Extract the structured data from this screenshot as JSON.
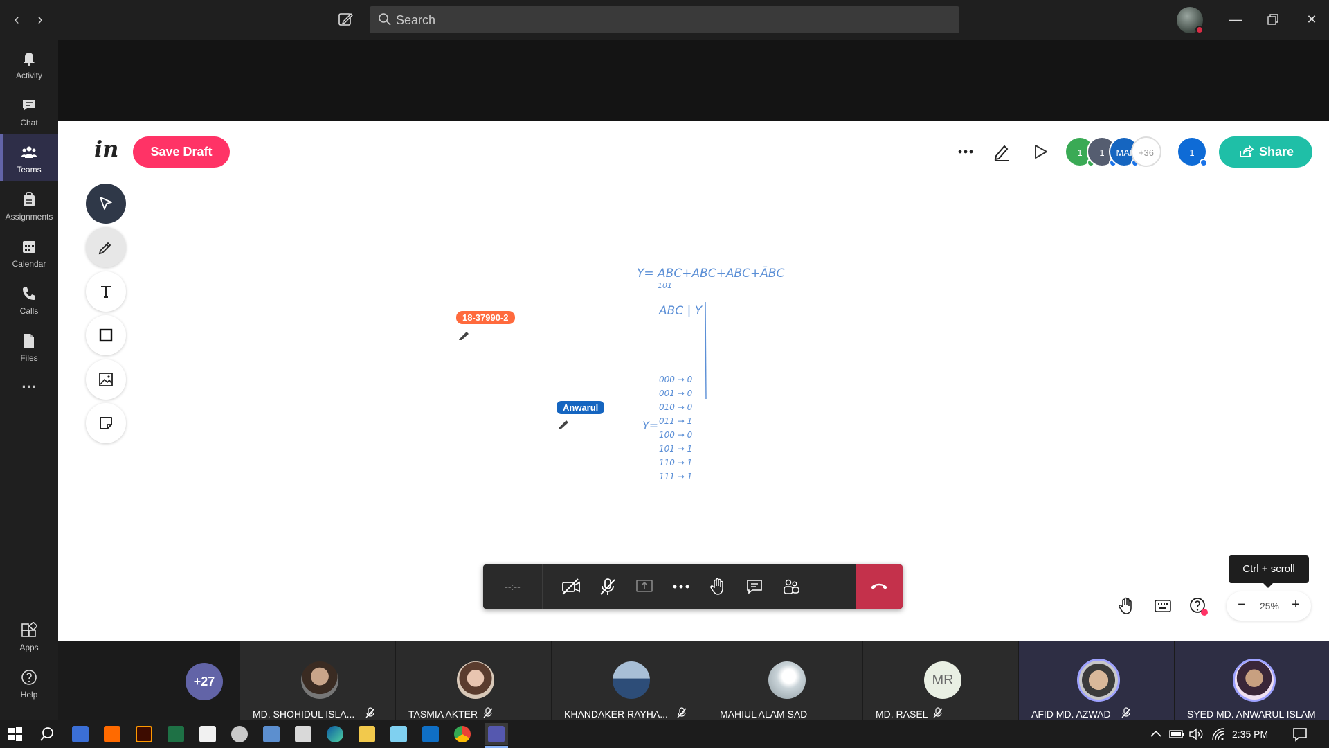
{
  "titlebar": {
    "search_placeholder": "Search"
  },
  "rail": {
    "items": [
      {
        "label": "Activity",
        "icon": "bell-icon"
      },
      {
        "label": "Chat",
        "icon": "chat-icon"
      },
      {
        "label": "Teams",
        "icon": "teams-icon",
        "active": true
      },
      {
        "label": "Assignments",
        "icon": "assignments-icon"
      },
      {
        "label": "Calendar",
        "icon": "calendar-icon"
      },
      {
        "label": "Calls",
        "icon": "phone-icon"
      },
      {
        "label": "Files",
        "icon": "files-icon"
      },
      {
        "label": "...",
        "icon": "more-icon"
      }
    ],
    "bottom": [
      {
        "label": "Apps",
        "icon": "apps-icon"
      },
      {
        "label": "Help",
        "icon": "help-icon"
      }
    ]
  },
  "invision": {
    "save_draft": "Save Draft",
    "share": "Share",
    "avatars": [
      "1",
      "1",
      "MAI",
      "+36"
    ],
    "self_avatar": "1",
    "cursor_tags": {
      "other": "18-37990-2",
      "self": "Anwarul"
    },
    "whiteboard": {
      "equation": "Y= ABC+ABC+ABC+ĀBC",
      "sub": "101",
      "header": "ABC | Y",
      "rows": [
        "000 → 0",
        "001 → 0",
        "010 → 0",
        "011 → 1",
        "100 → 0",
        "101 → 1",
        "110 → 1",
        "111 → 1"
      ],
      "bottom": "Y="
    },
    "tooltip": "Ctrl + scroll",
    "zoom": "25%"
  },
  "controls": {
    "timer": "--:--"
  },
  "participants": {
    "more_count": "+27",
    "tiles": [
      {
        "name": "MD. SHOHIDUL ISLA..."
      },
      {
        "name": "TASMIA AKTER"
      },
      {
        "name": "KHANDAKER RAYHA..."
      },
      {
        "name": "MAHIUL ALAM SAD"
      },
      {
        "name": "MD. RASEL",
        "initials": "MR"
      },
      {
        "name": "AFID MD. AZWAD"
      },
      {
        "name": "SYED MD. ANWARUL ISLAM"
      }
    ]
  },
  "taskbar": {
    "time": "2:35 PM"
  },
  "colors": {
    "teams_purple": "#6264a7",
    "invision_pink": "#ff3366",
    "share_teal": "#1fbfa7",
    "hangup_red": "#c4314b",
    "ink_blue": "#5b8fd6"
  }
}
